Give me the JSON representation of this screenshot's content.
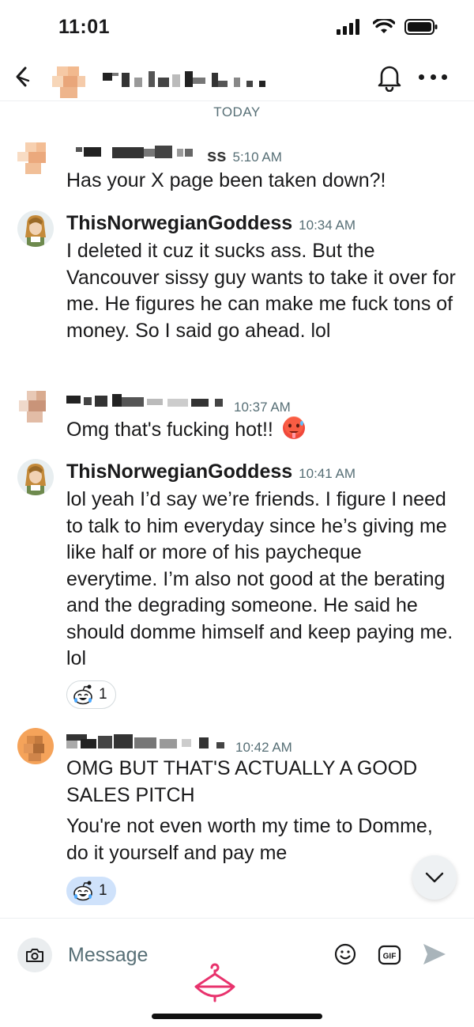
{
  "status_bar": {
    "time": "11:01"
  },
  "header": {
    "title": "",
    "bell_icon": "bell-icon",
    "more_icon": "more-dots-icon"
  },
  "date_separator": "TODAY",
  "messages": [
    {
      "username": "",
      "username_suffix": "ss",
      "time": "5:10 AM",
      "text": "Has your X page been taken down?!"
    },
    {
      "username": "ThisNorwegianGoddess",
      "time": "10:34 AM",
      "text": "I deleted it cuz it sucks ass. But the Vancouver sissy guy wants to take it over for me. He figures he can make me fuck tons of money. So I said go ahead. lol"
    },
    {
      "username": "",
      "time": "10:37 AM",
      "text": "Omg that's fucking hot!!",
      "emoji": "hot-face-emoji"
    },
    {
      "username": "ThisNorwegianGoddess",
      "time": "10:41 AM",
      "text": "lol yeah I’d say we’re friends. I figure I need to talk to him everyday since he’s giving me like half or more of his paycheque everytime. I’m also not good at the berating and the degrading someone. He said he should domme himself and keep paying me. lol",
      "reaction": {
        "icon": "laughing-snoo-icon",
        "count": "1"
      }
    },
    {
      "username": "",
      "time": "10:42 AM",
      "text": "OMG BUT THAT'S ACTUALLY A GOOD SALES PITCH",
      "text2": "You're not even worth my time to Domme, do it yourself and pay me",
      "reaction": {
        "icon": "laughing-snoo-icon",
        "count": "1"
      }
    }
  ],
  "composer": {
    "placeholder": "Message"
  },
  "colors": {
    "accent": "#e8336d",
    "meta": "#576f76",
    "reaction_active": "#cfe2fb"
  }
}
